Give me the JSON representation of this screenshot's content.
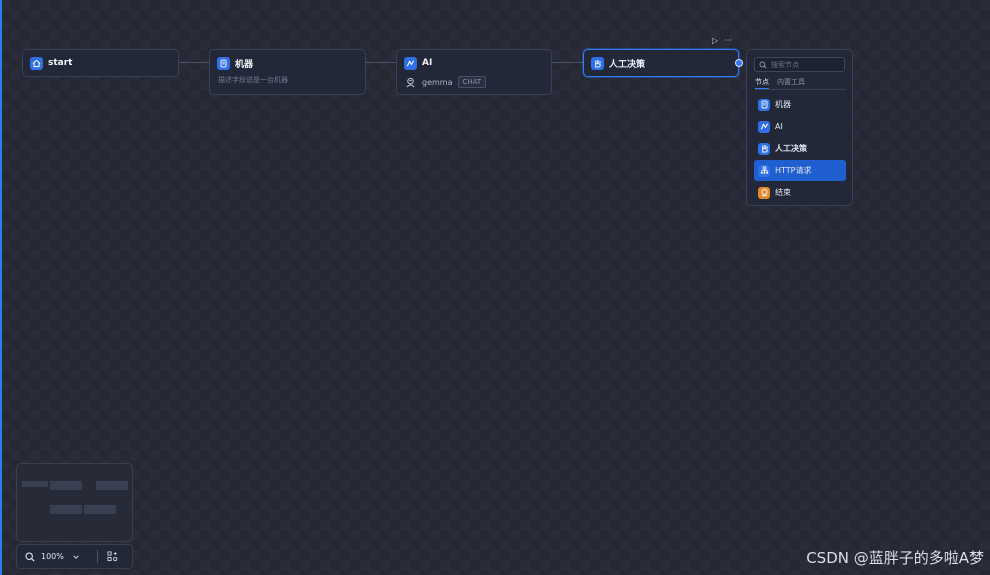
{
  "canvas": {
    "nodes": [
      {
        "id": "start",
        "title": "start",
        "icon": "home-icon"
      },
      {
        "id": "machine",
        "title": "机器",
        "description": "描述字段说是一台机器",
        "icon": "database-icon"
      },
      {
        "id": "ai",
        "title": "AI",
        "icon": "ai-icon",
        "model_name": "gemma",
        "model_tag": "CHAT"
      },
      {
        "id": "human",
        "title": "人工决策",
        "icon": "hand-icon"
      }
    ],
    "node_actions": {
      "run": "▷",
      "more": "···"
    }
  },
  "picker": {
    "search_placeholder": "搜索节点",
    "tabs": [
      {
        "label": "节点",
        "active": true
      },
      {
        "label": "内置工具",
        "active": false
      }
    ],
    "items": [
      {
        "label": "机器",
        "icon": "database-icon",
        "highlighted": false
      },
      {
        "label": "AI",
        "icon": "ai-icon",
        "highlighted": false
      },
      {
        "label": "人工决策",
        "icon": "hand-icon",
        "highlighted": false
      },
      {
        "label": "HTTP请求",
        "icon": "http-icon",
        "highlighted": true
      },
      {
        "label": "结束",
        "icon": "end-icon",
        "highlighted": false
      }
    ]
  },
  "toolbar": {
    "zoom": "100%"
  },
  "watermark": "CSDN @蓝胖子的多啦A梦",
  "colors": {
    "accent": "#3478f6",
    "end_icon": "#e28a2b",
    "highlight": "#1f5fcf"
  }
}
